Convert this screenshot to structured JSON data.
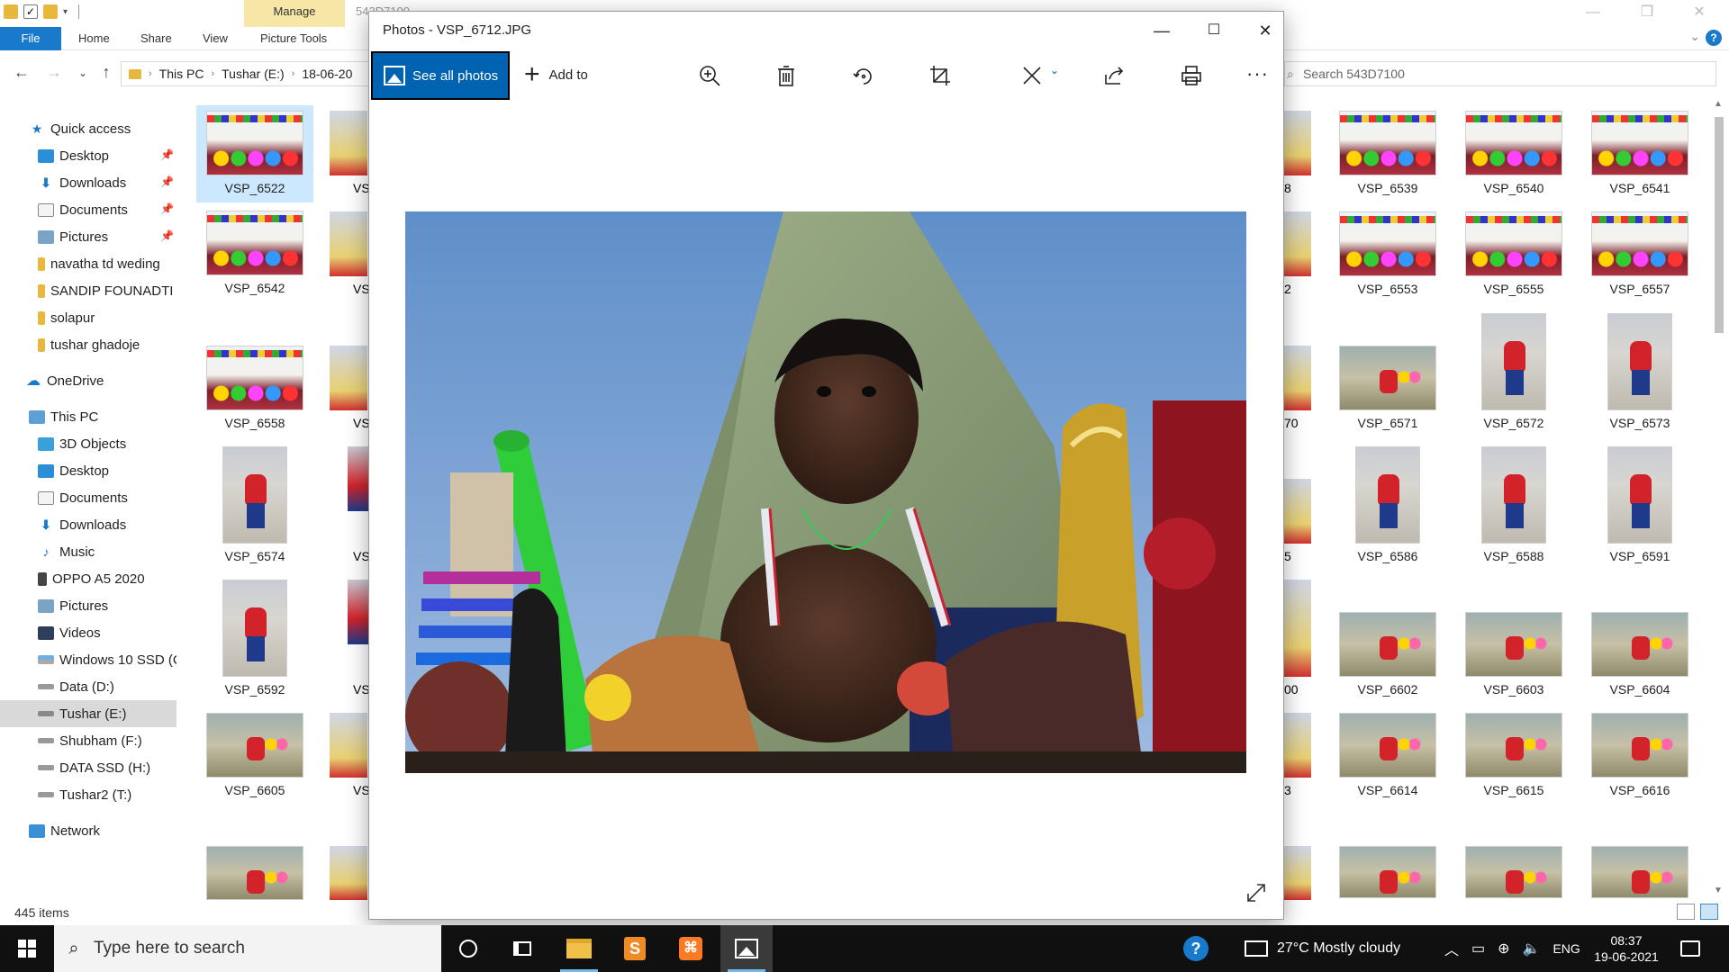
{
  "explorer": {
    "title_gray": "543D7100",
    "manage_tab": "Manage",
    "ribbon_tabs": [
      "File",
      "Home",
      "Share",
      "View",
      "Picture Tools"
    ],
    "breadcrumbs": [
      "This PC",
      "Tushar (E:)",
      "18-06-20"
    ],
    "search_placeholder": "Search 543D7100",
    "status": "445 items",
    "nav": {
      "quick_access": "Quick access",
      "qa_items": [
        "Desktop",
        "Downloads",
        "Documents",
        "Pictures",
        "navatha td weding",
        "SANDIP FOUNADTI",
        "solapur",
        "tushar ghadoje"
      ],
      "onedrive": "OneDrive",
      "this_pc": "This PC",
      "pc_items": [
        "3D Objects",
        "Desktop",
        "Documents",
        "Downloads",
        "Music",
        "OPPO A5 2020",
        "Pictures",
        "Videos",
        "Windows 10 SSD (C",
        "Data (D:)",
        "Tushar (E:)",
        "Shubham (F:)",
        "DATA SSD (H:)",
        "Tushar2 (T:)"
      ],
      "network": "Network"
    },
    "left_col1": [
      "VSP_6522",
      "VSP_6542",
      "VSP_6558",
      "VSP_6574",
      "VSP_6592",
      "VSP_6605"
    ],
    "left_col2": [
      "VS",
      "VS",
      "VS",
      "VS",
      "VS",
      "VS"
    ],
    "right_partial": [
      "8",
      "2",
      "70",
      "5",
      "00",
      "3"
    ],
    "right_grid": [
      [
        "VSP_6539",
        "VSP_6540",
        "VSP_6541"
      ],
      [
        "VSP_6553",
        "VSP_6555",
        "VSP_6557"
      ],
      [
        "VSP_6571",
        "VSP_6572",
        "VSP_6573"
      ],
      [
        "VSP_6586",
        "VSP_6588",
        "VSP_6591"
      ],
      [
        "VSP_6602",
        "VSP_6603",
        "VSP_6604"
      ],
      [
        "VSP_6614",
        "VSP_6615",
        "VSP_6616"
      ]
    ]
  },
  "photos": {
    "title": "Photos - VSP_6712.JPG",
    "see_all": "See all photos",
    "add_to": "Add to",
    "more": "···"
  },
  "taskbar": {
    "search_placeholder": "Type here to search",
    "weather": "27°C  Mostly cloudy",
    "lang": "ENG",
    "time": "08:37",
    "date": "19-06-2021"
  },
  "colors": {
    "accent": "#0063b1",
    "ribbon_file": "#1979ca",
    "manage_tab": "#f7e7a6",
    "taskbar": "#101010"
  },
  "icons": [
    "zoom-icon",
    "delete-icon",
    "rotate-icon",
    "crop-icon",
    "edit-icon",
    "share-icon",
    "print-icon",
    "more-icon",
    "expand-icon"
  ]
}
